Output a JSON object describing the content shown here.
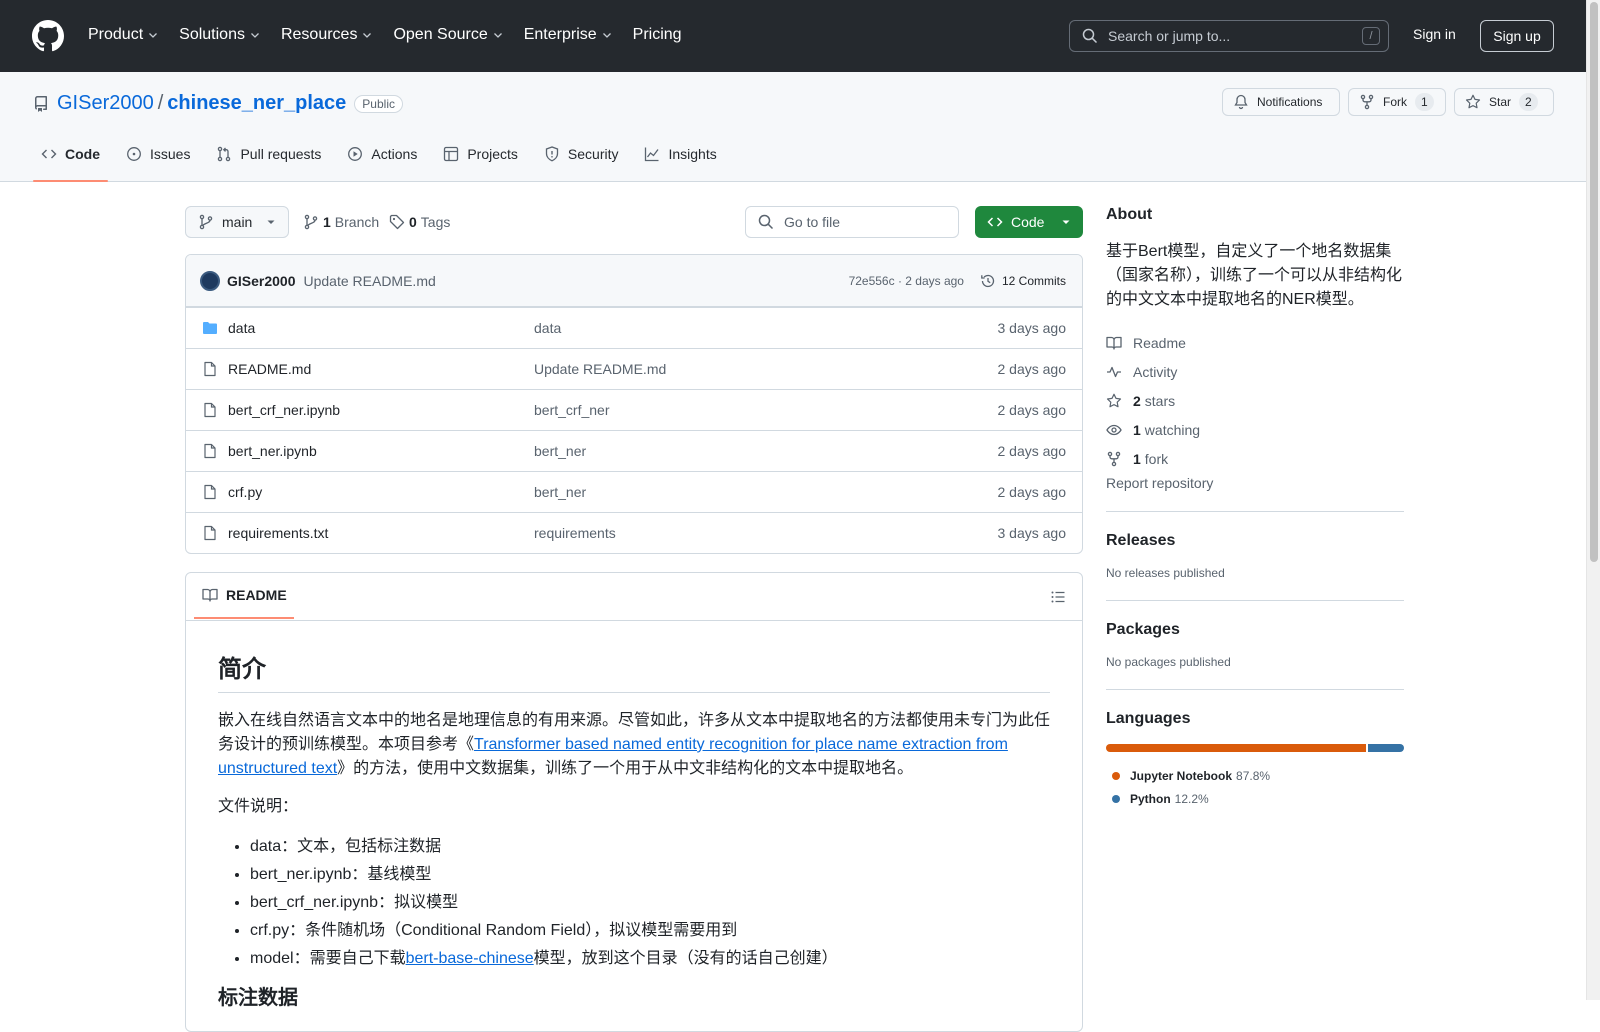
{
  "header": {
    "nav": [
      "Product",
      "Solutions",
      "Resources",
      "Open Source",
      "Enterprise",
      "Pricing"
    ],
    "search_placeholder": "Search or jump to...",
    "search_key": "/",
    "sign_in": "Sign in",
    "sign_up": "Sign up"
  },
  "repo": {
    "owner": "GISer2000",
    "separator": "/",
    "name": "chinese_ner_place",
    "visibility": "Public",
    "notifications": "Notifications",
    "fork_label": "Fork",
    "fork_count": "1",
    "star_label": "Star",
    "star_count": "2"
  },
  "tabs": [
    "Code",
    "Issues",
    "Pull requests",
    "Actions",
    "Projects",
    "Security",
    "Insights"
  ],
  "toolbar": {
    "branch": "main",
    "branch_count": "1",
    "branch_label": "Branch",
    "tag_count": "0",
    "tag_label": "Tags",
    "go_to_file": "Go to file",
    "code_button": "Code"
  },
  "commit": {
    "author": "GISer2000",
    "message": "Update README.md",
    "hash_date": "72e556c · 2 days ago",
    "commits": "12 Commits"
  },
  "files": [
    {
      "name": "data",
      "type": "dir",
      "message": "data",
      "date": "3 days ago"
    },
    {
      "name": "README.md",
      "type": "file",
      "message": "Update README.md",
      "date": "2 days ago"
    },
    {
      "name": "bert_crf_ner.ipynb",
      "type": "file",
      "message": "bert_crf_ner",
      "date": "2 days ago"
    },
    {
      "name": "bert_ner.ipynb",
      "type": "file",
      "message": "bert_ner",
      "date": "2 days ago"
    },
    {
      "name": "crf.py",
      "type": "file",
      "message": "bert_ner",
      "date": "2 days ago"
    },
    {
      "name": "requirements.txt",
      "type": "file",
      "message": "requirements",
      "date": "3 days ago"
    }
  ],
  "readme": {
    "tab": "README",
    "h1": "简介",
    "p1_a": "嵌入在线自然语言文本中的地名是地理信息的有用来源。尽管如此，许多从文本中提取地名的方法都使用未专门为此任务设计的预训练模型。本项目参考《",
    "p1_link": "Transformer based named entity recognition for place name extraction from unstructured text",
    "p1_b": "》的方法，使用中文数据集，训练了一个用于从中文非结构化的文本中提取地名。",
    "p2": "文件说明：",
    "list": [
      "data：文本，包括标注数据",
      "bert_ner.ipynb：基线模型",
      "bert_crf_ner.ipynb：拟议模型",
      "crf.py：条件随机场（Conditional Random Field），拟议模型需要用到"
    ],
    "model_a": "model：需要自己下载",
    "model_link": "bert-base-chinese",
    "model_b": "模型，放到这个目录（没有的话自己创建）",
    "h2": "标注数据"
  },
  "about": {
    "title": "About",
    "description": "基于Bert模型，自定义了一个地名数据集（国家名称），训练了一个可以从非结构化的中文文本中提取地名的NER模型。",
    "readme": "Readme",
    "activity": "Activity",
    "stars_count": "2",
    "stars_label": "stars",
    "watching_count": "1",
    "watching_label": "watching",
    "fork_count": "1",
    "fork_label": "fork",
    "report": "Report repository"
  },
  "releases": {
    "title": "Releases",
    "empty": "No releases published"
  },
  "packages": {
    "title": "Packages",
    "empty": "No packages published"
  },
  "languages": {
    "title": "Languages",
    "items": [
      {
        "name": "Jupyter Notebook",
        "percent": "87.8%",
        "value": 87.8,
        "color": "#DA5B0B"
      },
      {
        "name": "Python",
        "percent": "12.2%",
        "value": 12.2,
        "color": "#3572A5"
      }
    ]
  }
}
